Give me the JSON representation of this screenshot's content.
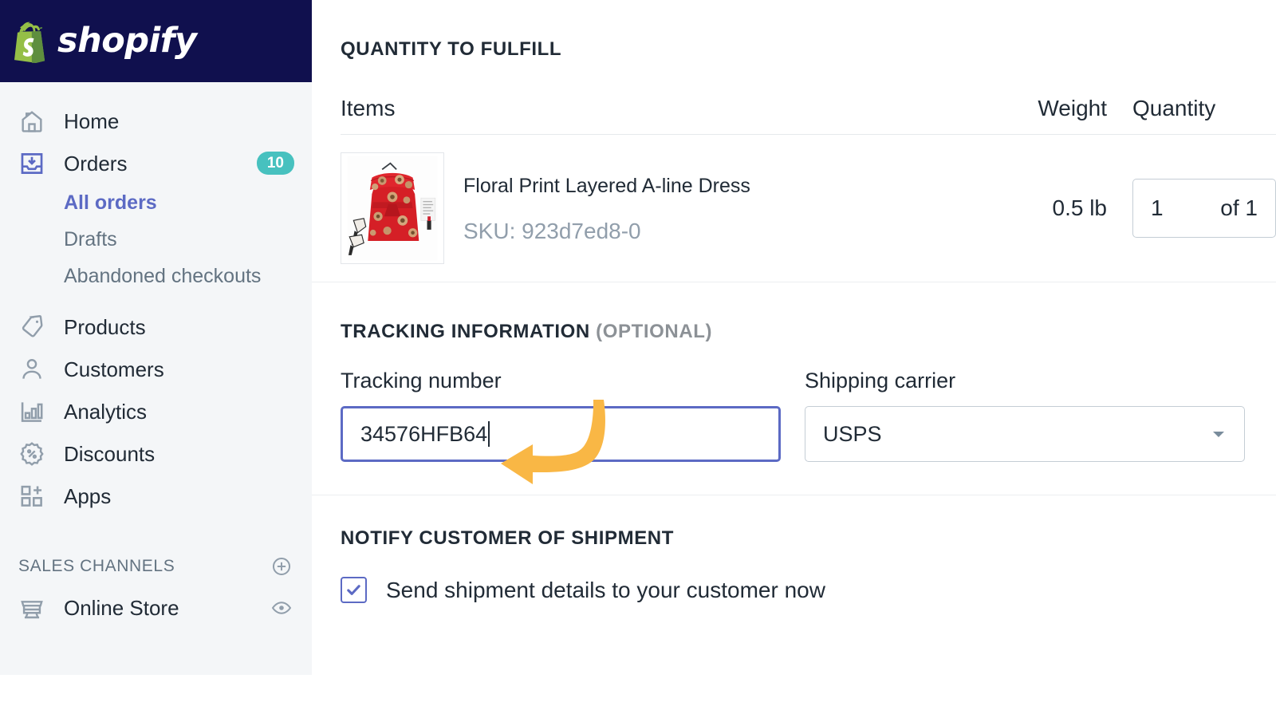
{
  "brand": {
    "name": "shopify",
    "logo_icon": "shopify-bag-icon",
    "header_bg": "#10104e",
    "bag_green": "#95bf47",
    "bag_green_dark": "#5e8e3e"
  },
  "sidebar": {
    "nav": [
      {
        "label": "Home",
        "icon": "home-icon",
        "active": false,
        "badge": ""
      },
      {
        "label": "Orders",
        "icon": "orders-inbox-icon",
        "active": true,
        "badge": "10"
      },
      {
        "label": "Products",
        "icon": "tag-icon",
        "active": false,
        "badge": ""
      },
      {
        "label": "Customers",
        "icon": "person-icon",
        "active": false,
        "badge": ""
      },
      {
        "label": "Analytics",
        "icon": "bar-chart-icon",
        "active": false,
        "badge": ""
      },
      {
        "label": "Discounts",
        "icon": "discount-percent-icon",
        "active": false,
        "badge": ""
      },
      {
        "label": "Apps",
        "icon": "apps-grid-plus-icon",
        "active": false,
        "badge": ""
      }
    ],
    "orders_sub": [
      {
        "label": "All orders",
        "selected": true
      },
      {
        "label": "Drafts",
        "selected": false
      },
      {
        "label": "Abandoned checkouts",
        "selected": false
      }
    ],
    "sales_channels": {
      "title": "SALES CHANNELS",
      "add_icon": "circle-plus-icon",
      "items": [
        {
          "label": "Online Store",
          "icon": "storefront-icon",
          "action_icon": "eye-icon"
        }
      ]
    },
    "badge_color": "#47c1bf",
    "active_color": "#5c6ac4"
  },
  "main": {
    "quantity_section": {
      "title": "QUANTITY TO FULFILL",
      "columns": {
        "items": "Items",
        "weight": "Weight",
        "quantity": "Quantity"
      },
      "rows": [
        {
          "product_name": "Floral Print Layered A-line Dress",
          "sku": "SKU: 923d7ed8-0",
          "weight": "0.5 lb",
          "qty_value": "1",
          "qty_of": "of 1",
          "thumbnail": "red-floral-dress-photo"
        }
      ]
    },
    "tracking_section": {
      "title": "TRACKING INFORMATION",
      "title_optional": "(OPTIONAL)",
      "tracking_number": {
        "label": "Tracking number",
        "value": "34576HFB64",
        "placeholder": "",
        "focused": true,
        "focus_color": "#5c6ac4"
      },
      "shipping_carrier": {
        "label": "Shipping carrier",
        "value": "USPS",
        "caret_icon": "chevron-down-icon",
        "options": [
          "USPS"
        ]
      }
    },
    "notify_section": {
      "title": "NOTIFY CUSTOMER OF SHIPMENT",
      "checkbox": {
        "label": "Send shipment details to your customer now",
        "checked": true,
        "icon": "checkmark-icon"
      }
    }
  },
  "annotation": {
    "arrow_icon": "curved-left-arrow-icon",
    "color": "#f9b745"
  }
}
